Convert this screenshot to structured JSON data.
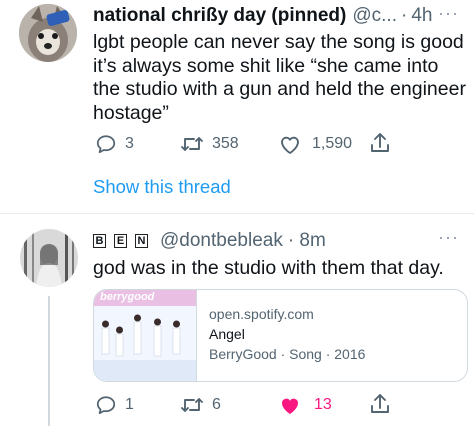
{
  "tweet1": {
    "display_name": "national chrißy day (pinned)",
    "handle": "@c...",
    "time": "4h",
    "more": "···",
    "lines": [
      "lgbt people can never say the song is good",
      "it’s always some shit like “she came into",
      "the studio with a gun and held the engineer",
      "hostage”"
    ],
    "replies": "3",
    "retweets": "358",
    "likes": "1,590",
    "show_thread": "Show this thread"
  },
  "tweet2": {
    "name_letters": [
      "B",
      "E",
      "N"
    ],
    "handle": "@dontbebleak",
    "time": "· 8m",
    "more": "···",
    "text": "god was in the studio with them that day.",
    "card": {
      "image_logo": "berrygood",
      "domain": "open.spotify.com",
      "title": "Angel",
      "subtitle": "BerryGood · Song · 2016"
    },
    "replies": "1",
    "retweets": "6",
    "likes": "13"
  },
  "colors": {
    "link": "#1d9bf0",
    "like_active": "#f91880",
    "muted": "#536471"
  }
}
